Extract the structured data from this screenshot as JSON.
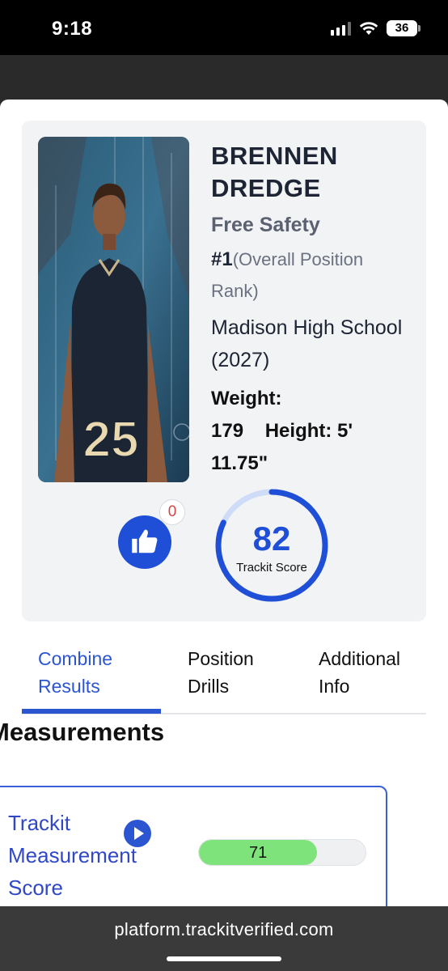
{
  "status_bar": {
    "time": "9:18",
    "battery": "36"
  },
  "profile": {
    "name": "BRENNEN DREDGE",
    "position": "Free Safety",
    "rank_number": "#1",
    "rank_label": "(Overall Position Rank)",
    "school": "Madison High School (2027)",
    "weight_label": "Weight:",
    "weight_value": "179",
    "height_label": "Height:",
    "height_value": "5' 11.75\"",
    "jersey_number": "25"
  },
  "likes": {
    "count": "0"
  },
  "score": {
    "value": "82",
    "label": "Trackit Score",
    "fraction": 0.82
  },
  "tabs": [
    {
      "label": "Combine Results",
      "active": true
    },
    {
      "label": "Position Drills",
      "active": false
    },
    {
      "label": "Additional Info",
      "active": false
    }
  ],
  "section": {
    "title": "Measurements"
  },
  "measurement": {
    "label": "Trackit Measurement Score",
    "value": "71",
    "fraction": 0.71
  },
  "browser": {
    "url": "platform.trackitverified.com"
  },
  "colors": {
    "accent": "#2c55d2",
    "bar_fill": "#7ee37a",
    "badge_text": "#d64545"
  }
}
